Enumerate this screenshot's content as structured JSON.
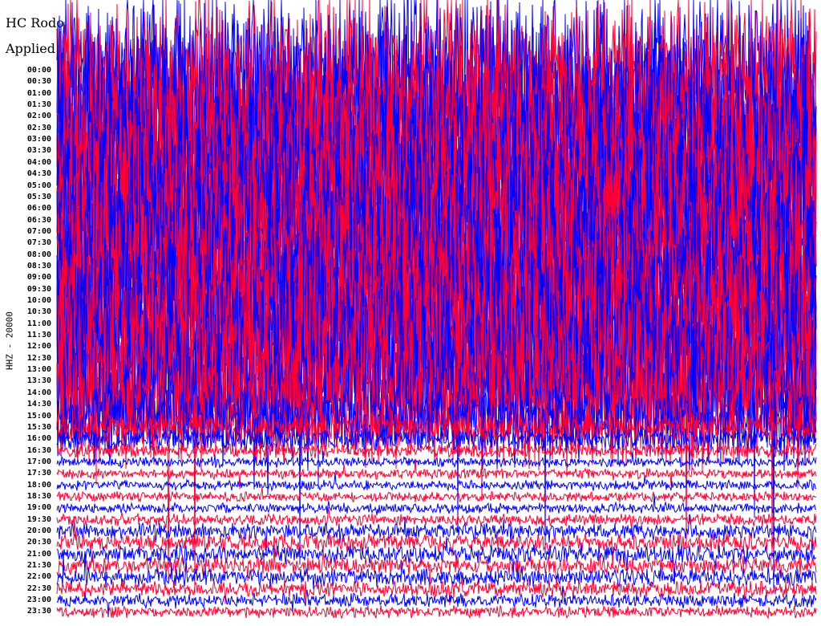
{
  "chart_data": {
    "type": "line",
    "title": "HC Rodo",
    "subtitle": "Applied",
    "ylabel": "HHZ - 20000",
    "tick_labels": [
      "00:00",
      "00:30",
      "01:00",
      "01:30",
      "02:00",
      "02:30",
      "03:00",
      "03:30",
      "04:00",
      "04:30",
      "05:00",
      "05:30",
      "06:00",
      "06:30",
      "07:00",
      "07:30",
      "08:00",
      "08:30",
      "09:00",
      "09:30",
      "10:00",
      "10:30",
      "11:00",
      "11:30",
      "12:00",
      "12:30",
      "13:00",
      "13:30",
      "14:00",
      "14:30",
      "15:00",
      "15:30",
      "16:00",
      "16:30",
      "17:00",
      "17:30",
      "18:00",
      "18:30",
      "19:00",
      "19:30",
      "20:00",
      "20:30",
      "21:00",
      "21:30",
      "22:00",
      "22:30",
      "23:00",
      "23:30"
    ],
    "series_colors": [
      "#0000ff",
      "#ff0033"
    ],
    "row_amplitudes": [
      9,
      9,
      9,
      9,
      9,
      9,
      9,
      9,
      9,
      9,
      9,
      9,
      9,
      9,
      9,
      9,
      9,
      9,
      9,
      9,
      9,
      9,
      9,
      9,
      9,
      9,
      8,
      8,
      7,
      6,
      3,
      1.6,
      1.2,
      0.7,
      0.5,
      0.5,
      0.5,
      0.5,
      0.5,
      0.6,
      0.8,
      0.9,
      0.9,
      0.9,
      0.9,
      0.8,
      0.7,
      0.6
    ]
  }
}
